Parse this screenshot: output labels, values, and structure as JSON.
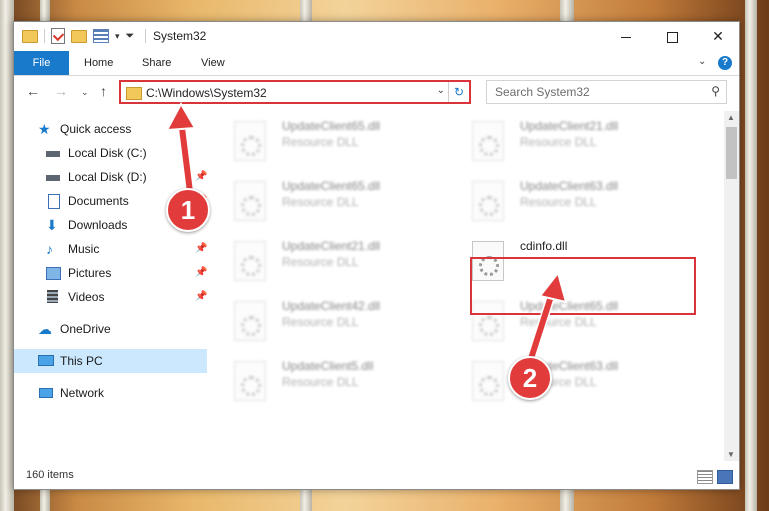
{
  "window": {
    "title": "System32",
    "controls": {
      "minimize": "minimize-icon",
      "maximize": "maximize-icon",
      "close": "✕"
    }
  },
  "ribbon": {
    "tabs": [
      {
        "label": "File"
      },
      {
        "label": "Home"
      },
      {
        "label": "Share"
      },
      {
        "label": "View"
      }
    ],
    "help": "?"
  },
  "address": {
    "path": "C:\\Windows\\System32",
    "search_placeholder": "Search System32"
  },
  "nav": {
    "items": [
      {
        "label": "Quick access",
        "icon": "star-icon"
      },
      {
        "label": "Local Disk (C:)",
        "icon": "drive-icon"
      },
      {
        "label": "Local Disk (D:)",
        "icon": "drive-icon"
      },
      {
        "label": "Documents",
        "icon": "documents-icon"
      },
      {
        "label": "Downloads",
        "icon": "downloads-icon"
      },
      {
        "label": "Music",
        "icon": "music-icon"
      },
      {
        "label": "Pictures",
        "icon": "pictures-icon"
      },
      {
        "label": "Videos",
        "icon": "videos-icon"
      },
      {
        "label": "OneDrive",
        "icon": "cloud-icon"
      },
      {
        "label": "This PC",
        "icon": "computer-icon"
      },
      {
        "label": "Network",
        "icon": "network-icon"
      }
    ]
  },
  "files": {
    "left": [
      {
        "name": "UpdateClient65.dll",
        "type": "Resource DLL"
      },
      {
        "name": "UpdateClient65.dll",
        "type": "Resource DLL"
      },
      {
        "name": "UpdateClient21.dll",
        "type": "Resource DLL"
      },
      {
        "name": "UpdateClient42.dll",
        "type": "Resource DLL"
      },
      {
        "name": "UpdateClient5.dll",
        "type": "Resource DLL"
      }
    ],
    "right": [
      {
        "name": "UpdateClient21.dll",
        "type": "Resource DLL"
      },
      {
        "name": "UpdateClient63.dll",
        "type": "Resource DLL"
      },
      {
        "name": "cdinfo.dll",
        "type": ""
      },
      {
        "name": "UpdateClient65.dll",
        "type": "Resource DLL"
      },
      {
        "name": "UpdateClient63.dll",
        "type": "Resource DLL"
      }
    ]
  },
  "status": {
    "count": "160 items"
  },
  "callouts": [
    {
      "label": "1"
    },
    {
      "label": "2"
    }
  ],
  "colors": {
    "accent": "#1979ca",
    "callout": "#e23b3b",
    "selection": "#cce8ff"
  }
}
